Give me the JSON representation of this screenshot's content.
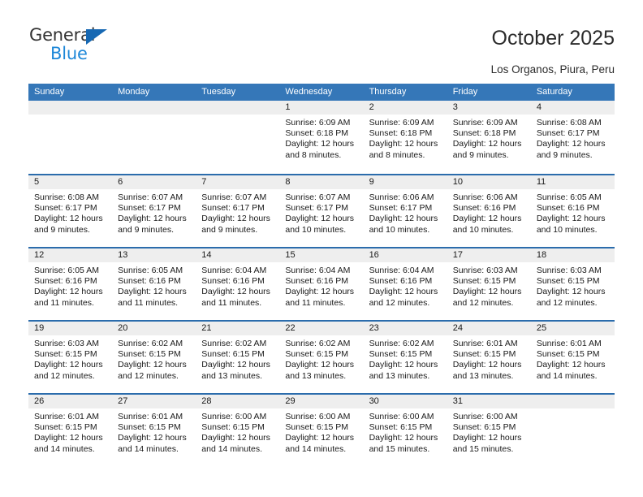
{
  "brand": {
    "name_part1": "General",
    "name_part2": "Blue",
    "accent_color": "#1668b3",
    "accent_color_light": "#1d87d8"
  },
  "header": {
    "title": "October 2025",
    "subtitle": "Los Organos, Piura, Peru"
  },
  "calendar": {
    "header_bg": "#3577b8",
    "row_divider": "#2b6cac",
    "date_band_bg": "#eeeeee",
    "weekdays": [
      "Sunday",
      "Monday",
      "Tuesday",
      "Wednesday",
      "Thursday",
      "Friday",
      "Saturday"
    ],
    "weeks": [
      [
        {
          "date": "",
          "empty": true
        },
        {
          "date": "",
          "empty": true
        },
        {
          "date": "",
          "empty": true
        },
        {
          "date": "1",
          "sunrise": "Sunrise: 6:09 AM",
          "sunset": "Sunset: 6:18 PM",
          "daylight": "Daylight: 12 hours and 8 minutes."
        },
        {
          "date": "2",
          "sunrise": "Sunrise: 6:09 AM",
          "sunset": "Sunset: 6:18 PM",
          "daylight": "Daylight: 12 hours and 8 minutes."
        },
        {
          "date": "3",
          "sunrise": "Sunrise: 6:09 AM",
          "sunset": "Sunset: 6:18 PM",
          "daylight": "Daylight: 12 hours and 9 minutes."
        },
        {
          "date": "4",
          "sunrise": "Sunrise: 6:08 AM",
          "sunset": "Sunset: 6:17 PM",
          "daylight": "Daylight: 12 hours and 9 minutes."
        }
      ],
      [
        {
          "date": "5",
          "sunrise": "Sunrise: 6:08 AM",
          "sunset": "Sunset: 6:17 PM",
          "daylight": "Daylight: 12 hours and 9 minutes."
        },
        {
          "date": "6",
          "sunrise": "Sunrise: 6:07 AM",
          "sunset": "Sunset: 6:17 PM",
          "daylight": "Daylight: 12 hours and 9 minutes."
        },
        {
          "date": "7",
          "sunrise": "Sunrise: 6:07 AM",
          "sunset": "Sunset: 6:17 PM",
          "daylight": "Daylight: 12 hours and 9 minutes."
        },
        {
          "date": "8",
          "sunrise": "Sunrise: 6:07 AM",
          "sunset": "Sunset: 6:17 PM",
          "daylight": "Daylight: 12 hours and 10 minutes."
        },
        {
          "date": "9",
          "sunrise": "Sunrise: 6:06 AM",
          "sunset": "Sunset: 6:17 PM",
          "daylight": "Daylight: 12 hours and 10 minutes."
        },
        {
          "date": "10",
          "sunrise": "Sunrise: 6:06 AM",
          "sunset": "Sunset: 6:16 PM",
          "daylight": "Daylight: 12 hours and 10 minutes."
        },
        {
          "date": "11",
          "sunrise": "Sunrise: 6:05 AM",
          "sunset": "Sunset: 6:16 PM",
          "daylight": "Daylight: 12 hours and 10 minutes."
        }
      ],
      [
        {
          "date": "12",
          "sunrise": "Sunrise: 6:05 AM",
          "sunset": "Sunset: 6:16 PM",
          "daylight": "Daylight: 12 hours and 11 minutes."
        },
        {
          "date": "13",
          "sunrise": "Sunrise: 6:05 AM",
          "sunset": "Sunset: 6:16 PM",
          "daylight": "Daylight: 12 hours and 11 minutes."
        },
        {
          "date": "14",
          "sunrise": "Sunrise: 6:04 AM",
          "sunset": "Sunset: 6:16 PM",
          "daylight": "Daylight: 12 hours and 11 minutes."
        },
        {
          "date": "15",
          "sunrise": "Sunrise: 6:04 AM",
          "sunset": "Sunset: 6:16 PM",
          "daylight": "Daylight: 12 hours and 11 minutes."
        },
        {
          "date": "16",
          "sunrise": "Sunrise: 6:04 AM",
          "sunset": "Sunset: 6:16 PM",
          "daylight": "Daylight: 12 hours and 12 minutes."
        },
        {
          "date": "17",
          "sunrise": "Sunrise: 6:03 AM",
          "sunset": "Sunset: 6:15 PM",
          "daylight": "Daylight: 12 hours and 12 minutes."
        },
        {
          "date": "18",
          "sunrise": "Sunrise: 6:03 AM",
          "sunset": "Sunset: 6:15 PM",
          "daylight": "Daylight: 12 hours and 12 minutes."
        }
      ],
      [
        {
          "date": "19",
          "sunrise": "Sunrise: 6:03 AM",
          "sunset": "Sunset: 6:15 PM",
          "daylight": "Daylight: 12 hours and 12 minutes."
        },
        {
          "date": "20",
          "sunrise": "Sunrise: 6:02 AM",
          "sunset": "Sunset: 6:15 PM",
          "daylight": "Daylight: 12 hours and 12 minutes."
        },
        {
          "date": "21",
          "sunrise": "Sunrise: 6:02 AM",
          "sunset": "Sunset: 6:15 PM",
          "daylight": "Daylight: 12 hours and 13 minutes."
        },
        {
          "date": "22",
          "sunrise": "Sunrise: 6:02 AM",
          "sunset": "Sunset: 6:15 PM",
          "daylight": "Daylight: 12 hours and 13 minutes."
        },
        {
          "date": "23",
          "sunrise": "Sunrise: 6:02 AM",
          "sunset": "Sunset: 6:15 PM",
          "daylight": "Daylight: 12 hours and 13 minutes."
        },
        {
          "date": "24",
          "sunrise": "Sunrise: 6:01 AM",
          "sunset": "Sunset: 6:15 PM",
          "daylight": "Daylight: 12 hours and 13 minutes."
        },
        {
          "date": "25",
          "sunrise": "Sunrise: 6:01 AM",
          "sunset": "Sunset: 6:15 PM",
          "daylight": "Daylight: 12 hours and 14 minutes."
        }
      ],
      [
        {
          "date": "26",
          "sunrise": "Sunrise: 6:01 AM",
          "sunset": "Sunset: 6:15 PM",
          "daylight": "Daylight: 12 hours and 14 minutes."
        },
        {
          "date": "27",
          "sunrise": "Sunrise: 6:01 AM",
          "sunset": "Sunset: 6:15 PM",
          "daylight": "Daylight: 12 hours and 14 minutes."
        },
        {
          "date": "28",
          "sunrise": "Sunrise: 6:00 AM",
          "sunset": "Sunset: 6:15 PM",
          "daylight": "Daylight: 12 hours and 14 minutes."
        },
        {
          "date": "29",
          "sunrise": "Sunrise: 6:00 AM",
          "sunset": "Sunset: 6:15 PM",
          "daylight": "Daylight: 12 hours and 14 minutes."
        },
        {
          "date": "30",
          "sunrise": "Sunrise: 6:00 AM",
          "sunset": "Sunset: 6:15 PM",
          "daylight": "Daylight: 12 hours and 15 minutes."
        },
        {
          "date": "31",
          "sunrise": "Sunrise: 6:00 AM",
          "sunset": "Sunset: 6:15 PM",
          "daylight": "Daylight: 12 hours and 15 minutes."
        },
        {
          "date": "",
          "empty": true
        }
      ]
    ]
  }
}
